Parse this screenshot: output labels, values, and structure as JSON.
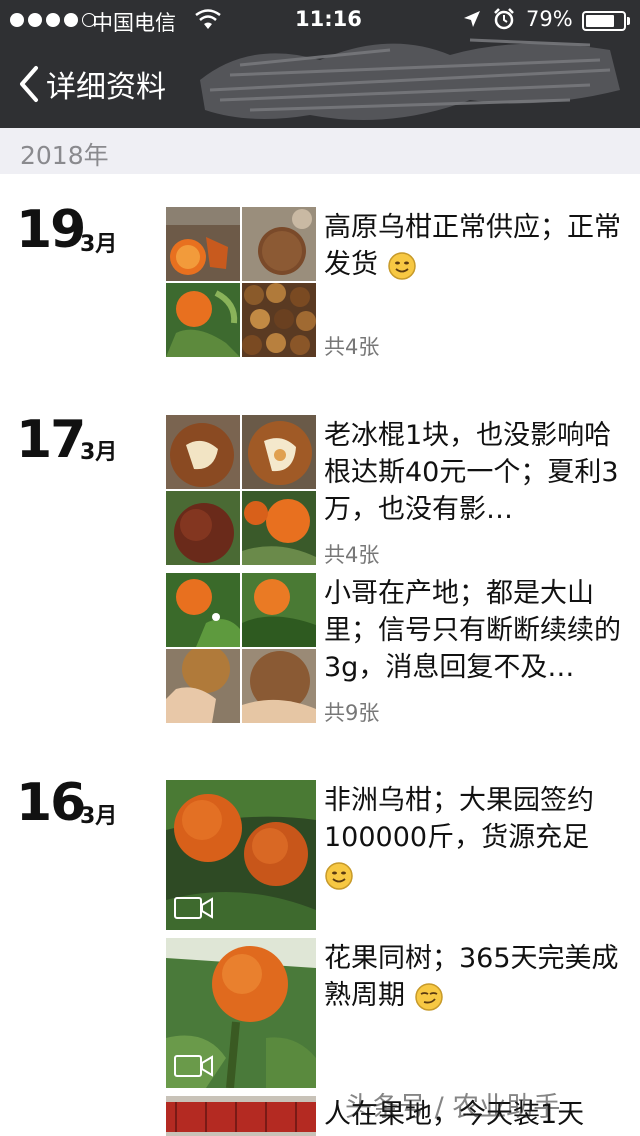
{
  "status": {
    "carrier": "中国电信",
    "time": "11:16",
    "battery": "79%",
    "battery_level": 0.79
  },
  "nav": {
    "back_label": "详细资料"
  },
  "year": "2018年",
  "entries": [
    {
      "day": "19",
      "month": "3月",
      "posts": [
        {
          "text": "高原乌柑正常供应；正常发货",
          "count": "共4张"
        }
      ]
    },
    {
      "day": "17",
      "month": "3月",
      "posts": [
        {
          "text": "老冰棍1块，也没影响哈根达斯40元一个；夏利3万，也没有影…",
          "count": "共4张"
        },
        {
          "text": "小哥在产地；都是大山里；信号只有断断续续的3g，消息回复不及…",
          "count": "共9张"
        }
      ]
    },
    {
      "day": "16",
      "month": "3月",
      "posts": [
        {
          "text": "非洲乌柑；大果园签约100000斤，货源充足"
        },
        {
          "text": "花果同树；365天完美成熟周期"
        },
        {
          "text": "人在果地，今天装1天"
        }
      ]
    }
  ],
  "watermark": "头条号 / 农业助手",
  "colors": {
    "nav_bg": "#2f3033",
    "year_bg": "#efeff4",
    "orange": "#e8701f"
  },
  "icons": [
    "signal-dots-icon",
    "wifi-icon",
    "location-arrow-icon",
    "alarm-icon",
    "battery-icon",
    "back-chevron-icon",
    "smile-emoji-icon",
    "video-icon"
  ]
}
